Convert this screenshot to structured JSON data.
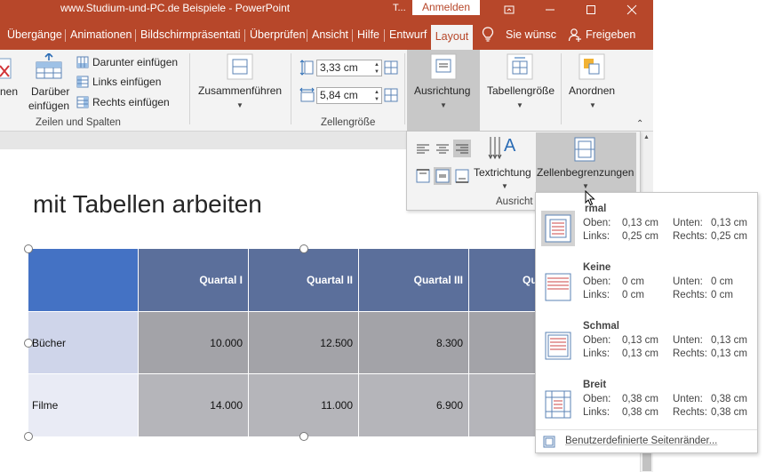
{
  "titlebar": {
    "title": "www.Studium-und-PC.de Beispiele  -  PowerPoint",
    "context_tab": "T...",
    "signin": "Anmelden"
  },
  "tabs": [
    "Übergänge",
    "Animationen",
    "Bildschirmpräsentatic",
    "Überprüfen",
    "Ansicht",
    "Hilfe",
    "Entwurf",
    "Layout"
  ],
  "tell_me": "Sie wünsc",
  "share": "Freigeben",
  "ribbon": {
    "cut_label": "nen",
    "insert_above": [
      "Darüber",
      "einfügen"
    ],
    "insert_below": "Darunter einfügen",
    "insert_left": "Links einfügen",
    "insert_right": "Rechts einfügen",
    "rows_cols_group": "Zeilen und Spalten",
    "merge": "Zusammenführen",
    "height_value": "3,33 cm",
    "width_value": "5,84 cm",
    "cellsize_group": "Zellengröße",
    "alignment": "Ausrichtung",
    "table_size": "Tabellengröße",
    "arrange": "Anordnen"
  },
  "alignment_panel": {
    "text_direction": "Textrichtung",
    "cell_margins": "Zellenbegrenzungen",
    "group_label": "Ausricht"
  },
  "slide": {
    "title": "mit Tabellen arbeiten",
    "table": {
      "headers": [
        "",
        "Quartal I",
        "Quartal II",
        "Quartal III",
        "Qu"
      ],
      "rows": [
        {
          "label": "Bücher",
          "values": [
            "10.000",
            "12.500",
            "8.300"
          ]
        },
        {
          "label": "Filme",
          "values": [
            "14.000",
            "11.000",
            "6.900"
          ]
        }
      ]
    }
  },
  "margins_menu": {
    "items": [
      {
        "name": "rmal",
        "top_label": "Oben:",
        "top": "0,13 cm",
        "bottom_label": "Unten:",
        "bottom": "0,13 cm",
        "left_label": "Links:",
        "left": "0,25 cm",
        "right_label": "Rechts:",
        "right": "0,25 cm"
      },
      {
        "name": "Keine",
        "top_label": "Oben:",
        "top": "0 cm",
        "bottom_label": "Unten:",
        "bottom": "0 cm",
        "left_label": "Links:",
        "left": "0 cm",
        "right_label": "Rechts:",
        "right": "0 cm"
      },
      {
        "name": "Schmal",
        "top_label": "Oben:",
        "top": "0,13 cm",
        "bottom_label": "Unten:",
        "bottom": "0,13 cm",
        "left_label": "Links:",
        "left": "0,13 cm",
        "right_label": "Rechts:",
        "right": "0,13 cm"
      },
      {
        "name": "Breit",
        "top_label": "Oben:",
        "top": "0,38 cm",
        "bottom_label": "Unten:",
        "bottom": "0,38 cm",
        "left_label": "Links:",
        "left": "0,38 cm",
        "right_label": "Rechts:",
        "right": "0,38 cm"
      }
    ],
    "custom": "Benutzerdefinierte Seitenränder..."
  },
  "colors": {
    "accent": "#b7472a",
    "table_header": "#5b6f9b",
    "table_header_first": "#4472c4",
    "selected_gray": "#c8c8c8"
  }
}
